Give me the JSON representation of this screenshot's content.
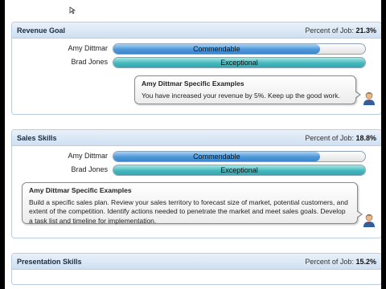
{
  "sections": [
    {
      "title": "Revenue Goal",
      "pct_label": "Percent of Job:",
      "pct_value": "21.3%",
      "bars": [
        {
          "name": "Amy Dittmar",
          "rating": "Commendable",
          "level": 0.82,
          "color": "#4d97d9"
        },
        {
          "name": "Brad Jones",
          "rating": "Exceptional",
          "level": 1.0,
          "color": "#45b8bd"
        }
      ],
      "examples": {
        "title": "Amy Dittmar Specific Examples",
        "body": "You have increased your revenue by 5%. Keep up the good work."
      }
    },
    {
      "title": "Sales Skills",
      "pct_label": "Percent of Job:",
      "pct_value": "18.8%",
      "bars": [
        {
          "name": "Amy Dittmar",
          "rating": "Commendable",
          "level": 0.82,
          "color": "#4d97d9"
        },
        {
          "name": "Brad Jones",
          "rating": "Exceptional",
          "level": 1.0,
          "color": "#45b8bd"
        }
      ],
      "examples": {
        "title": "Amy Dittmar Specific Examples",
        "body": "Build a specific sales plan. Review your sales territory to forecast size of market, potential customers, and extent of the competition. Identify actions needed to penetrate the market and meet sales goals. Develop a task list and timeline for implementation."
      }
    },
    {
      "title": "Presentation Skills",
      "pct_label": "Percent of Job:",
      "pct_value": "15.2%"
    }
  ],
  "icons": {
    "avatar": "person-avatar-icon",
    "cursor": "mouse-cursor-icon"
  }
}
